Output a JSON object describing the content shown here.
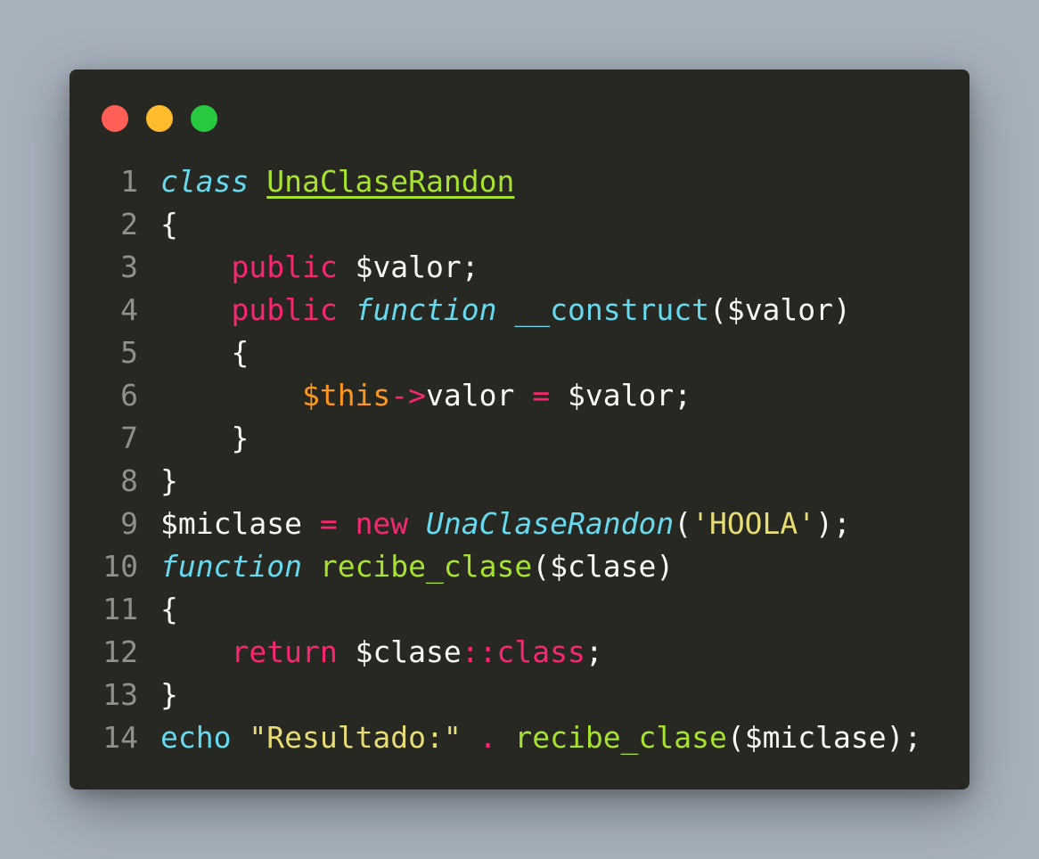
{
  "window": {
    "traffic_lights": [
      {
        "name": "close",
        "color": "#ff5f56"
      },
      {
        "name": "minimize",
        "color": "#ffbd2e"
      },
      {
        "name": "maximize",
        "color": "#27c93f"
      }
    ]
  },
  "colors": {
    "background": "#272822",
    "text": "#f8f8f2",
    "keyword": "#f92672",
    "storage": "#66d9ef",
    "class_name": "#a6e22e",
    "string": "#e6db74",
    "variable_this": "#fd971f",
    "line_number": "#90908a"
  },
  "code": [
    {
      "n": "1",
      "tokens": [
        {
          "t": "class",
          "c": "storage",
          "i": true
        },
        {
          "t": " "
        },
        {
          "t": "UnaClaseRandon",
          "c": "class_name",
          "u": true
        }
      ]
    },
    {
      "n": "2",
      "tokens": [
        {
          "t": "{"
        }
      ]
    },
    {
      "n": "3",
      "tokens": [
        {
          "t": "    "
        },
        {
          "t": "public",
          "c": "keyword"
        },
        {
          "t": " $valor;"
        }
      ]
    },
    {
      "n": "4",
      "tokens": [
        {
          "t": "    "
        },
        {
          "t": "public",
          "c": "keyword"
        },
        {
          "t": " "
        },
        {
          "t": "function",
          "c": "storage",
          "i": true
        },
        {
          "t": " "
        },
        {
          "t": "__construct",
          "c": "storage"
        },
        {
          "t": "($valor)"
        }
      ]
    },
    {
      "n": "5",
      "tokens": [
        {
          "t": "    {"
        }
      ]
    },
    {
      "n": "6",
      "tokens": [
        {
          "t": "        "
        },
        {
          "t": "$this",
          "c": "variable_this"
        },
        {
          "t": "->",
          "c": "keyword"
        },
        {
          "t": "valor "
        },
        {
          "t": "=",
          "c": "keyword"
        },
        {
          "t": " $valor;"
        }
      ]
    },
    {
      "n": "7",
      "tokens": [
        {
          "t": "    }"
        }
      ]
    },
    {
      "n": "8",
      "tokens": [
        {
          "t": "}"
        }
      ]
    },
    {
      "n": "9",
      "tokens": [
        {
          "t": "$miclase "
        },
        {
          "t": "=",
          "c": "keyword"
        },
        {
          "t": " "
        },
        {
          "t": "new",
          "c": "keyword"
        },
        {
          "t": " "
        },
        {
          "t": "UnaClaseRandon",
          "c": "storage",
          "i": true
        },
        {
          "t": "("
        },
        {
          "t": "'HOOLA'",
          "c": "string"
        },
        {
          "t": ");"
        }
      ]
    },
    {
      "n": "10",
      "tokens": [
        {
          "t": "function",
          "c": "storage",
          "i": true
        },
        {
          "t": " "
        },
        {
          "t": "recibe_clase",
          "c": "class_name"
        },
        {
          "t": "($clase)"
        }
      ]
    },
    {
      "n": "11",
      "tokens": [
        {
          "t": "{"
        }
      ]
    },
    {
      "n": "12",
      "tokens": [
        {
          "t": "    "
        },
        {
          "t": "return",
          "c": "keyword"
        },
        {
          "t": " $clase"
        },
        {
          "t": "::",
          "c": "keyword"
        },
        {
          "t": "class",
          "c": "keyword"
        },
        {
          "t": ";"
        }
      ]
    },
    {
      "n": "13",
      "tokens": [
        {
          "t": "}"
        }
      ]
    },
    {
      "n": "14",
      "tokens": [
        {
          "t": "echo",
          "c": "storage"
        },
        {
          "t": " "
        },
        {
          "t": "\"Resultado:\"",
          "c": "string"
        },
        {
          "t": " "
        },
        {
          "t": ".",
          "c": "keyword"
        },
        {
          "t": " "
        },
        {
          "t": "recibe_clase",
          "c": "class_name"
        },
        {
          "t": "($miclase);"
        }
      ]
    }
  ]
}
